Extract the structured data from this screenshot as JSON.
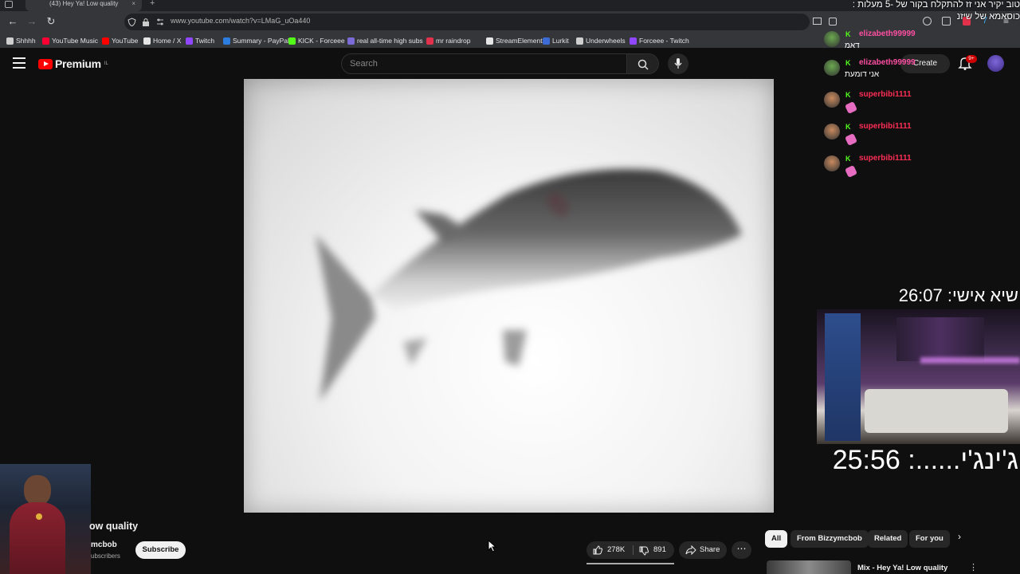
{
  "browser": {
    "tab_title": "(43) Hey Ya! Low quality",
    "tab_close": "×",
    "url": "www.youtube.com/watch?v=LMaG_uOa440",
    "bookmarks": [
      {
        "label": "Shhhh",
        "icon": "folder-icon",
        "color": "#cfcfcf"
      },
      {
        "label": "YouTube Music",
        "icon": "youtube-music-icon",
        "color": "#ff0033"
      },
      {
        "label": "YouTube",
        "icon": "youtube-icon",
        "color": "#ff0000"
      },
      {
        "label": "Home / X",
        "icon": "x-icon",
        "color": "#e6e6e6"
      },
      {
        "label": "Twitch",
        "icon": "twitch-icon",
        "color": "#9146ff"
      },
      {
        "label": "Summary - PayPal",
        "icon": "paypal-icon",
        "color": "#2b7de0"
      },
      {
        "label": "KICK - Forceee",
        "icon": "kick-icon",
        "color": "#53fc18"
      },
      {
        "label": "real all-time high subs",
        "icon": "pen-icon",
        "color": "#7a6bd8"
      },
      {
        "label": "mr raindrop",
        "icon": "raindrop-icon",
        "color": "#e2324b"
      },
      {
        "label": "StreamElements -",
        "icon": "streamelements-icon",
        "color": "#e6e6e6"
      },
      {
        "label": "Lurkit",
        "icon": "lurkit-icon",
        "color": "#3c6bd6"
      },
      {
        "label": "Underwheels",
        "icon": "folder-icon",
        "color": "#cfcfcf"
      },
      {
        "label": "Forceee - Twitch",
        "icon": "twitch-icon",
        "color": "#9146ff"
      }
    ]
  },
  "youtube": {
    "logo_text": "Premium",
    "logo_region": "IL",
    "search_placeholder": "Search",
    "create_label": "Create",
    "notification_count": "9+"
  },
  "video": {
    "title_visible": "ow quality",
    "channel_visible": "mcbob",
    "subscribers_visible": "ubscribers",
    "subscribe_label": "Subscribe",
    "likes": "278K",
    "dislikes": "891",
    "share_label": "Share",
    "more_label": "⋯"
  },
  "chips": [
    "All",
    "From Bizzymcbob",
    "Related",
    "For you"
  ],
  "chip_next": "›",
  "up_next": {
    "title": "Mix - Hey Ya! Low quality",
    "more": "⋮"
  },
  "stream_overlay": {
    "top_line1": "טוב יקיר אני זז להתקלח בקור של -5 מעלות :",
    "top_line2": "כוסאמא של שיזנ",
    "chat": [
      {
        "user": "elizabeth99999",
        "message": "דאמ",
        "user_color": "#ff4fa3",
        "avatar_color": "#6aa84f"
      },
      {
        "user": "elizabeth99999",
        "message": "אני דומעת",
        "user_color": "#ff4fa3",
        "avatar_color": "#6aa84f"
      },
      {
        "user": "superbibi1111",
        "message": "",
        "user_color": "#ff2d55",
        "avatar_color": "#c98a5e"
      },
      {
        "user": "superbibi1111",
        "message": "",
        "user_color": "#ff2d55",
        "avatar_color": "#c98a5e"
      },
      {
        "user": "superbibi1111",
        "message": "",
        "user_color": "#ff2d55",
        "avatar_color": "#c98a5e"
      }
    ],
    "timer_top": "שיא אישי: 26:07",
    "timer_bottom": "ג'ינג'י......: 25:56"
  }
}
